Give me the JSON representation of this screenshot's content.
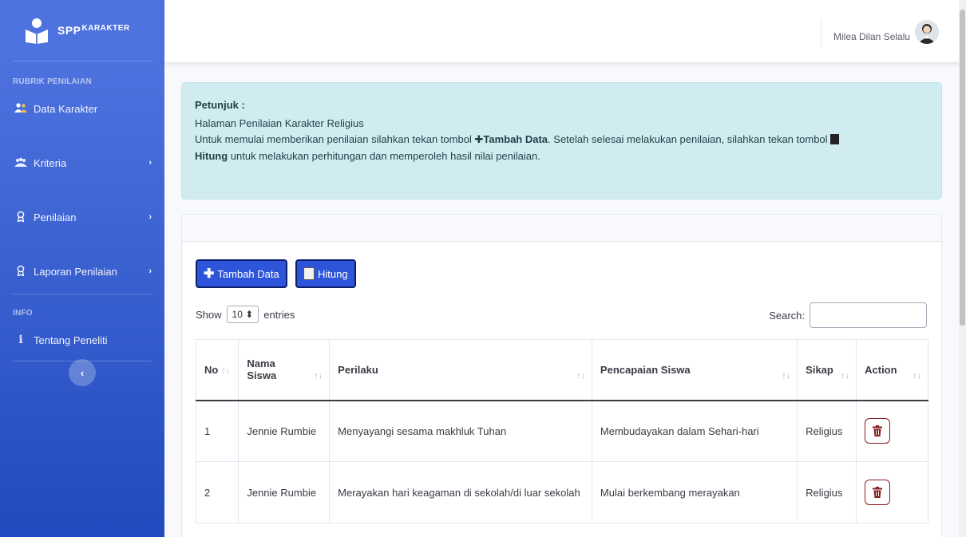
{
  "brand": {
    "prefix": "SPP",
    "suffix": "KARAKTER"
  },
  "sidebar": {
    "heading_rubrik": "RUBRIK PENILAIAN",
    "heading_info": "INFO",
    "items": [
      {
        "label": "Data Karakter",
        "icon": "users-icon"
      },
      {
        "label": "Kriteria",
        "icon": "users-cog-icon"
      },
      {
        "label": "Penilaian",
        "icon": "award-icon"
      },
      {
        "label": "Laporan Penilaian",
        "icon": "award-icon"
      },
      {
        "label": "Tentang Peneliti",
        "icon": "info-icon"
      }
    ],
    "chevron": "›",
    "toggle": "‹"
  },
  "topbar": {
    "user_name": "Milea Dilan Selalu"
  },
  "alert": {
    "title": "Petunjuk :",
    "line1": "Halaman Penilaian Karakter Religius",
    "line2_a": "Untuk memulai memberikan penilaian silahkan tekan tombol ",
    "line2_btn": "Tambah Data",
    "line2_b": ". Setelah selesai melakukan penilaian, silahkan tekan tombol ",
    "line3_btn": "Hitung",
    "line3": " untuk melakukan perhitungan dan memperoleh hasil nilai penilaian."
  },
  "toolbar": {
    "tambah_label": "Tambah Data",
    "hitung_label": "Hitung"
  },
  "datatable": {
    "show_label": "Show",
    "entries_value": "10",
    "entries_label": "entries",
    "search_label": "Search:",
    "columns": [
      "No",
      "Nama Siswa",
      "Perilaku",
      "Pencapaian Siswa",
      "Sikap",
      "Action"
    ],
    "rows": [
      {
        "no": "1",
        "nama": "Jennie Rumbie",
        "perilaku": "Menyayangi sesama makhluk Tuhan",
        "pencapaian": "Membudayakan dalam Sehari-hari",
        "sikap": "Religius"
      },
      {
        "no": "2",
        "nama": "Jennie Rumbie",
        "perilaku": "Merayakan hari keagaman di sekolah/di luar sekolah",
        "pencapaian": "Mulai berkembang merayakan",
        "sikap": "Religius"
      }
    ]
  },
  "colors": {
    "sidebar": "#4e73df",
    "primary_btn": "#2e55d9",
    "alert_bg": "#d1ecf1",
    "danger": "#8a1c1c"
  }
}
